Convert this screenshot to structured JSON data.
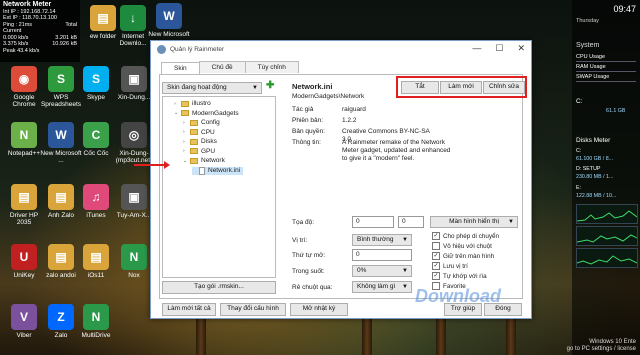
{
  "network_meter": {
    "title": "Network Meter",
    "int_ip": "Int IP : 192.168.72.14",
    "ext_ip": "Ext IP : 118.70.13.100",
    "ping": "Ping : 21ms",
    "current_label": "Current",
    "total_label": "Total",
    "down_current": "0.000 kb/s",
    "down_total": "3.201 kB",
    "up_current": "3.375 kb/s",
    "up_total": "10.926 kB",
    "peak": "Peak 43.4 kb/s"
  },
  "desktop_icons": [
    {
      "label": "Google Chrome",
      "color": "#dd4b39",
      "glyph": "◉"
    },
    {
      "label": "WPS Spreadsheets",
      "color": "#2e9a3e",
      "glyph": "S"
    },
    {
      "label": "Skype",
      "color": "#00aff0",
      "glyph": "S"
    },
    {
      "label": "Xin-Dung...",
      "color": "#555555",
      "glyph": "▣"
    },
    {
      "label": "Notepad++",
      "color": "#6cb04a",
      "glyph": "N"
    },
    {
      "label": "New Microsoft ...",
      "color": "#2b579a",
      "glyph": "W"
    },
    {
      "label": "Cốc Cốc",
      "color": "#3aa04a",
      "glyph": "C"
    },
    {
      "label": "Xin-Dung-(mp3cut.net)",
      "color": "#444444",
      "glyph": "◎"
    },
    {
      "label": "Driver HP 2035",
      "color": "#d9a53a",
      "glyph": "▤"
    },
    {
      "label": "Anh Zalo",
      "color": "#d9a53a",
      "glyph": "▤"
    },
    {
      "label": "iTunes",
      "color": "#e04a7a",
      "glyph": "♫"
    },
    {
      "label": "Tuy-Am-X...",
      "color": "#555555",
      "glyph": "▣"
    },
    {
      "label": "UniKey",
      "color": "#c02020",
      "glyph": "U"
    },
    {
      "label": "zalo andoi",
      "color": "#d9a53a",
      "glyph": "▤"
    },
    {
      "label": "iOs11",
      "color": "#d9a53a",
      "glyph": "▤"
    },
    {
      "label": "Nox",
      "color": "#2a9a4a",
      "glyph": "N"
    },
    {
      "label": "Viber",
      "color": "#7b519d",
      "glyph": "V"
    },
    {
      "label": "Zalo",
      "color": "#0068ff",
      "glyph": "Z"
    },
    {
      "label": "MultiDrive",
      "color": "#2a9a4a",
      "glyph": "N"
    }
  ],
  "top_icons": [
    {
      "label": "ew folder",
      "color": "#d9a53a",
      "glyph": "▤"
    },
    {
      "label": "Internet Downlo...",
      "color": "#1e8a3e",
      "glyph": "↓"
    },
    {
      "label": "New Microsoft ...",
      "color": "#2b579a",
      "glyph": "W"
    }
  ],
  "right_panel": {
    "clock": "09:47",
    "day": "Thursday",
    "system_title": "System",
    "rows": [
      {
        "label": "CPU Usage"
      },
      {
        "label": "RAM Usage"
      },
      {
        "label": "SWAP Usage"
      }
    ],
    "drive_c_label": "C:",
    "drive_c_value": "61.1 GB",
    "disks_title": "Disks Meter",
    "disk1_name": "C:",
    "disk1_val": "61.100 GB / 8...",
    "disk2_name": "D: SETUP",
    "disk2_val": "230.80 MB / 1...",
    "disk3_name": "E:",
    "disk3_val": "122.88 MB / 10..."
  },
  "dialog": {
    "title": "Quản lý Rainmeter",
    "minimize": "—",
    "maximize": "☐",
    "close": "✕",
    "tabs": [
      "Skin",
      "Chủ đề",
      "Tùy chỉnh"
    ],
    "active_tab": "Skin",
    "skins_combo": "Skin đang hoạt động",
    "tree": [
      {
        "label": "illustro",
        "type": "folder",
        "level": 1,
        "toggle": "›"
      },
      {
        "label": "ModernGadgets",
        "type": "folder",
        "level": 1,
        "toggle": "⌄"
      },
      {
        "label": "Config",
        "type": "folder",
        "level": 2,
        "toggle": "›"
      },
      {
        "label": "CPU",
        "type": "folder",
        "level": 2,
        "toggle": "›"
      },
      {
        "label": "Disks",
        "type": "folder",
        "level": 2,
        "toggle": "›"
      },
      {
        "label": "GPU",
        "type": "folder",
        "level": 2,
        "toggle": "›"
      },
      {
        "label": "Network",
        "type": "folder",
        "level": 2,
        "toggle": "⌄"
      },
      {
        "label": "Network.ini",
        "type": "file",
        "level": 3,
        "toggle": "",
        "selected": true
      }
    ],
    "create_package": "Tạo gói .rmskin...",
    "skin_title": "Network.ini",
    "skin_path": "ModernGadgets\\Network",
    "meta": [
      {
        "label": "Tác giả",
        "value": "raiguard"
      },
      {
        "label": "Phiên bản:",
        "value": "1.2.2"
      },
      {
        "label": "Bản quyền:",
        "value": "Creative Commons BY-NC-SA 3.0"
      },
      {
        "label": "Thông tin:",
        "value": "A Rainmeter remake of the Network Meter gadget, updated and enhanced to give it a \"modern\" feel."
      }
    ],
    "btn_off": "Tắt",
    "btn_refresh": "Làm mới",
    "btn_edit": "Chỉnh sửa",
    "coords_label": "Tọa độ:",
    "coord_x": "0",
    "coord_y": "0",
    "position_label": "Vị trí:",
    "position_val": "Bình thường",
    "load_order_label": "Thứ tự mở:",
    "load_order_val": "0",
    "transparency_label": "Trong suốt:",
    "transparency_val": "0%",
    "on_hover_label": "Rê chuột qua:",
    "on_hover_val": "Không làm gì",
    "display_btn": "Màn hình hiển thị",
    "checks": [
      {
        "label": "Cho phép di chuyển",
        "checked": true
      },
      {
        "label": "Vô hiệu với chuột",
        "checked": false
      },
      {
        "label": "Giữ trên màn hình",
        "checked": true
      },
      {
        "label": "Lưu vị trí",
        "checked": true
      },
      {
        "label": "Tự khớp với rìa",
        "checked": true
      },
      {
        "label": "Favorite",
        "checked": false
      }
    ],
    "refresh_all": "Làm mới tất cả",
    "save_layout": "Thay đổi cấu hình",
    "open_log": "Mở nhật ký",
    "help": "Trợ giúp",
    "close_btn": "Đóng"
  },
  "watermark": "Download",
  "os_text_1": "Windows 10 Ente",
  "os_text_2": "go to PC settings / license"
}
